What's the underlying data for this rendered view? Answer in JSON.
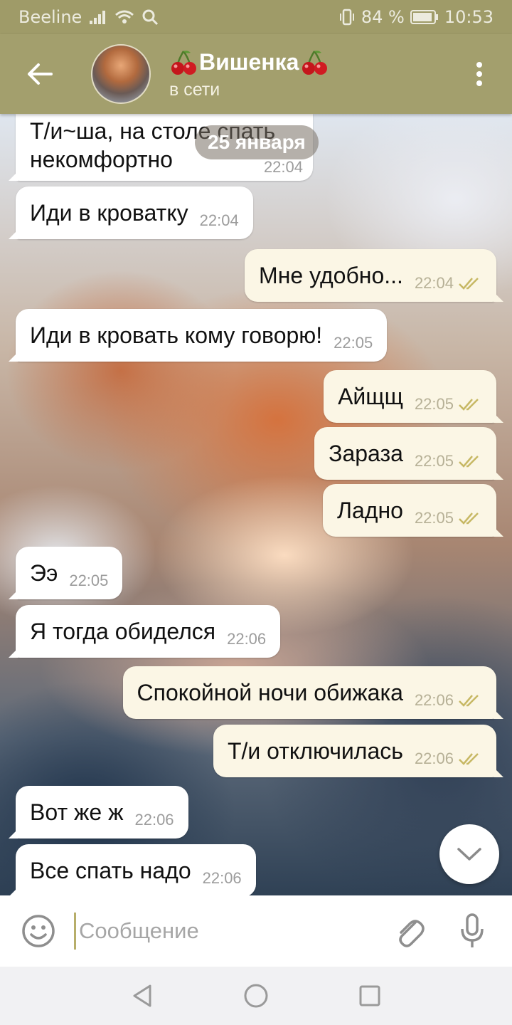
{
  "status_bar": {
    "carrier": "Beeline",
    "battery": "84 %",
    "time": "10:53",
    "icons": [
      "signal-icon",
      "wifi-icon",
      "search-icon",
      "vibrate-icon",
      "battery-icon"
    ]
  },
  "header": {
    "title": "Вишенка",
    "status": "в сети",
    "title_decoration": "cherry-icon",
    "accent_color": "#a39f6d"
  },
  "chat": {
    "date_label": "25 января",
    "messages": [
      {
        "dir": "in",
        "text": "Т/и~ша, на столе спать некомфортно",
        "time": "22:04"
      },
      {
        "dir": "in",
        "text": "Иди в кроватку",
        "time": "22:04"
      },
      {
        "dir": "out",
        "text": "Мне удобно...",
        "time": "22:04",
        "read": true
      },
      {
        "dir": "in",
        "text": "Иди в кровать кому говорю!",
        "time": "22:05"
      },
      {
        "dir": "out",
        "text": "Айщщ",
        "time": "22:05",
        "read": true
      },
      {
        "dir": "out",
        "text": "Зараза",
        "time": "22:05",
        "read": true
      },
      {
        "dir": "out",
        "text": "Ладно",
        "time": "22:05",
        "read": true
      },
      {
        "dir": "in",
        "text": "Ээ",
        "time": "22:05"
      },
      {
        "dir": "in",
        "text": "Я тогда обиделся",
        "time": "22:06"
      },
      {
        "dir": "out",
        "text": "Спокойной ночи обижака",
        "time": "22:06",
        "read": true
      },
      {
        "dir": "out",
        "text": "Т/и отключилась",
        "time": "22:06",
        "read": true
      },
      {
        "dir": "in",
        "text": "Вот же ж",
        "time": "22:06"
      },
      {
        "dir": "in",
        "text": "Все спать надо",
        "time": "22:06"
      }
    ]
  },
  "composer": {
    "placeholder": "Сообщение",
    "value": ""
  },
  "nav": {
    "buttons": [
      "back-triangle-icon",
      "home-circle-icon",
      "recents-square-icon"
    ]
  }
}
